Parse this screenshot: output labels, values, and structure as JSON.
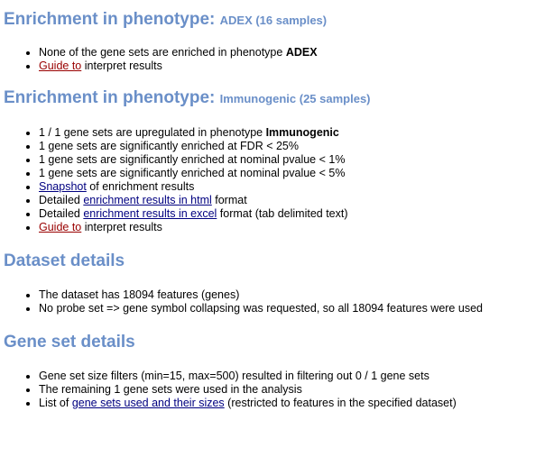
{
  "section1": {
    "heading_main": "Enrichment in phenotype: ",
    "heading_small": "ADEX (16 samples)",
    "item1_pre": "None of the gene sets are enriched in phenotype ",
    "item1_bold": "ADEX",
    "guide_link": "Guide to",
    "guide_post": " interpret results"
  },
  "section2": {
    "heading_main": "Enrichment in phenotype: ",
    "heading_small": "Immunogenic (25 samples)",
    "item1_pre": "1 / 1 gene sets are upregulated in phenotype ",
    "item1_bold": "Immunogenic",
    "item2": "1 gene sets are significantly enriched at FDR < 25%",
    "item3": "1 gene sets are significantly enriched at nominal pvalue < 1%",
    "item4": "1 gene sets are significantly enriched at nominal pvalue < 5%",
    "snapshot_link": "Snapshot",
    "snapshot_post": " of enrichment results",
    "html_pre": "Detailed ",
    "html_link": "enrichment results in html",
    "html_post": " format",
    "excel_pre": "Detailed ",
    "excel_link": "enrichment results in excel",
    "excel_post": " format (tab delimited text)",
    "guide_link": "Guide to",
    "guide_post": " interpret results"
  },
  "section3": {
    "heading": "Dataset details",
    "item1": "The dataset has 18094 features (genes)",
    "item2": "No probe set => gene symbol collapsing was requested, so all 18094 features were used"
  },
  "section4": {
    "heading": "Gene set details",
    "item1": "Gene set size filters (min=15, max=500) resulted in filtering out 0 / 1 gene sets",
    "item2": "The remaining 1 gene sets were used in the analysis",
    "item3_pre": "List of ",
    "item3_link": "gene sets used and their sizes",
    "item3_post": " (restricted to features in the specified dataset)"
  }
}
